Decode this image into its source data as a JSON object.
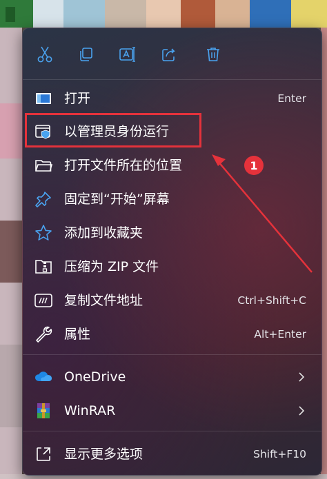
{
  "toolbar": {
    "icons": [
      "cut-icon",
      "copy-icon",
      "rename-icon",
      "share-icon",
      "delete-icon"
    ]
  },
  "menu_items": [
    {
      "label": "打开",
      "shortcut": "Enter",
      "icon": "open-icon"
    },
    {
      "label": "以管理员身份运行",
      "shortcut": "",
      "icon": "shield-icon"
    },
    {
      "label": "打开文件所在的位置",
      "shortcut": "",
      "icon": "folder-icon"
    },
    {
      "label": "固定到“开始”屏幕",
      "shortcut": "",
      "icon": "pin-icon"
    },
    {
      "label": "添加到收藏夹",
      "shortcut": "",
      "icon": "star-icon"
    },
    {
      "label": "压缩为 ZIP 文件",
      "shortcut": "",
      "icon": "zip-icon"
    },
    {
      "label": "复制文件地址",
      "shortcut": "Ctrl+Shift+C",
      "icon": "path-icon"
    },
    {
      "label": "属性",
      "shortcut": "Alt+Enter",
      "icon": "wrench-icon"
    }
  ],
  "app_items": [
    {
      "label": "OneDrive",
      "icon": "onedrive-icon",
      "submenu": true
    },
    {
      "label": "WinRAR",
      "icon": "winrar-icon",
      "submenu": true
    }
  ],
  "more": {
    "label": "显示更多选项",
    "shortcut": "Shift+F10",
    "icon": "more-options-icon"
  },
  "annotation": {
    "badge": "1",
    "color": "#e5323b"
  },
  "colors": {
    "accent_blue": "#4aa3f0",
    "annotation_red": "#e5323b"
  }
}
